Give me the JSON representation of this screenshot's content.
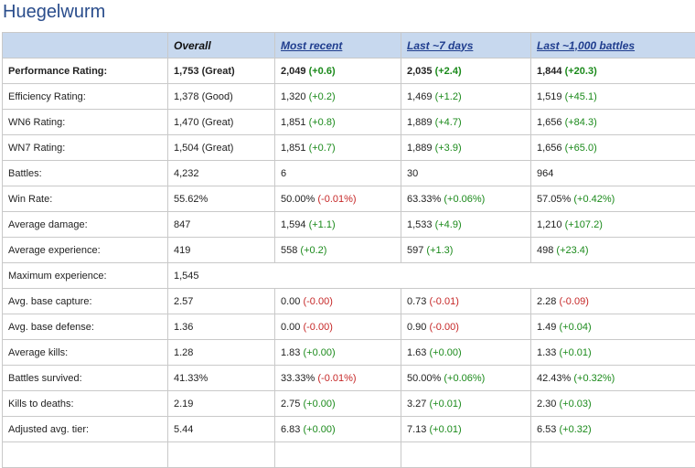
{
  "page": {
    "title": "Huegelwurm"
  },
  "columns": [
    {
      "label": "",
      "link": false
    },
    {
      "label": "Overall",
      "link": false
    },
    {
      "label": "Most recent",
      "link": true
    },
    {
      "label": "Last ~7 days",
      "link": true
    },
    {
      "label": "Last ~1,000 battles",
      "link": true
    }
  ],
  "rows": [
    {
      "label": "Performance Rating:",
      "bold": true,
      "cells": [
        {
          "v": "1,753 (Great)",
          "d": "",
          "s": ""
        },
        {
          "v": "2,049",
          "d": "(+0.6)",
          "s": "up"
        },
        {
          "v": "2,035",
          "d": "(+2.4)",
          "s": "up"
        },
        {
          "v": "1,844",
          "d": "(+20.3)",
          "s": "up"
        }
      ]
    },
    {
      "label": "Efficiency Rating:",
      "bold": false,
      "cells": [
        {
          "v": "1,378 (Good)",
          "d": "",
          "s": ""
        },
        {
          "v": "1,320",
          "d": "(+0.2)",
          "s": "up"
        },
        {
          "v": "1,469",
          "d": "(+1.2)",
          "s": "up"
        },
        {
          "v": "1,519",
          "d": "(+45.1)",
          "s": "up"
        }
      ]
    },
    {
      "label": "WN6 Rating:",
      "bold": false,
      "cells": [
        {
          "v": "1,470 (Great)",
          "d": "",
          "s": ""
        },
        {
          "v": "1,851",
          "d": "(+0.8)",
          "s": "up"
        },
        {
          "v": "1,889",
          "d": "(+4.7)",
          "s": "up"
        },
        {
          "v": "1,656",
          "d": "(+84.3)",
          "s": "up"
        }
      ]
    },
    {
      "label": "WN7 Rating:",
      "bold": false,
      "cells": [
        {
          "v": "1,504 (Great)",
          "d": "",
          "s": ""
        },
        {
          "v": "1,851",
          "d": "(+0.7)",
          "s": "up"
        },
        {
          "v": "1,889",
          "d": "(+3.9)",
          "s": "up"
        },
        {
          "v": "1,656",
          "d": "(+65.0)",
          "s": "up"
        }
      ]
    },
    {
      "label": "Battles:",
      "bold": false,
      "cells": [
        {
          "v": "4,232",
          "d": "",
          "s": ""
        },
        {
          "v": "6",
          "d": "",
          "s": ""
        },
        {
          "v": "30",
          "d": "",
          "s": ""
        },
        {
          "v": "964",
          "d": "",
          "s": ""
        }
      ]
    },
    {
      "label": "Win Rate:",
      "bold": false,
      "cells": [
        {
          "v": "55.62%",
          "d": "",
          "s": ""
        },
        {
          "v": "50.00%",
          "d": "(-0.01%)",
          "s": "down"
        },
        {
          "v": "63.33%",
          "d": "(+0.06%)",
          "s": "up"
        },
        {
          "v": "57.05%",
          "d": "(+0.42%)",
          "s": "up"
        }
      ]
    },
    {
      "label": "Average damage:",
      "bold": false,
      "cells": [
        {
          "v": "847",
          "d": "",
          "s": ""
        },
        {
          "v": "1,594",
          "d": "(+1.1)",
          "s": "up"
        },
        {
          "v": "1,533",
          "d": "(+4.9)",
          "s": "up"
        },
        {
          "v": "1,210",
          "d": "(+107.2)",
          "s": "up"
        }
      ]
    },
    {
      "label": "Average experience:",
      "bold": false,
      "cells": [
        {
          "v": "419",
          "d": "",
          "s": ""
        },
        {
          "v": "558",
          "d": "(+0.2)",
          "s": "up"
        },
        {
          "v": "597",
          "d": "(+1.3)",
          "s": "up"
        },
        {
          "v": "498",
          "d": "(+23.4)",
          "s": "up"
        }
      ]
    },
    {
      "label": "Maximum experience:",
      "bold": false,
      "span": true,
      "cells": [
        {
          "v": "1,545",
          "d": "",
          "s": ""
        }
      ]
    },
    {
      "label": "Avg. base capture:",
      "bold": false,
      "cells": [
        {
          "v": "2.57",
          "d": "",
          "s": ""
        },
        {
          "v": "0.00",
          "d": "(-0.00)",
          "s": "down"
        },
        {
          "v": "0.73",
          "d": "(-0.01)",
          "s": "down"
        },
        {
          "v": "2.28",
          "d": "(-0.09)",
          "s": "down"
        }
      ]
    },
    {
      "label": "Avg. base defense:",
      "bold": false,
      "cells": [
        {
          "v": "1.36",
          "d": "",
          "s": ""
        },
        {
          "v": "0.00",
          "d": "(-0.00)",
          "s": "down"
        },
        {
          "v": "0.90",
          "d": "(-0.00)",
          "s": "down"
        },
        {
          "v": "1.49",
          "d": "(+0.04)",
          "s": "up"
        }
      ]
    },
    {
      "label": "Average kills:",
      "bold": false,
      "cells": [
        {
          "v": "1.28",
          "d": "",
          "s": ""
        },
        {
          "v": "1.83",
          "d": "(+0.00)",
          "s": "up"
        },
        {
          "v": "1.63",
          "d": "(+0.00)",
          "s": "up"
        },
        {
          "v": "1.33",
          "d": "(+0.01)",
          "s": "up"
        }
      ]
    },
    {
      "label": "Battles survived:",
      "bold": false,
      "cells": [
        {
          "v": "41.33%",
          "d": "",
          "s": ""
        },
        {
          "v": "33.33%",
          "d": "(-0.01%)",
          "s": "down"
        },
        {
          "v": "50.00%",
          "d": "(+0.06%)",
          "s": "up"
        },
        {
          "v": "42.43%",
          "d": "(+0.32%)",
          "s": "up"
        }
      ]
    },
    {
      "label": "Kills to deaths:",
      "bold": false,
      "cells": [
        {
          "v": "2.19",
          "d": "",
          "s": ""
        },
        {
          "v": "2.75",
          "d": "(+0.00)",
          "s": "up"
        },
        {
          "v": "3.27",
          "d": "(+0.01)",
          "s": "up"
        },
        {
          "v": "2.30",
          "d": "(+0.03)",
          "s": "up"
        }
      ]
    },
    {
      "label": "Adjusted avg. tier:",
      "bold": false,
      "cells": [
        {
          "v": "5.44",
          "d": "",
          "s": ""
        },
        {
          "v": "6.83",
          "d": "(+0.00)",
          "s": "up"
        },
        {
          "v": "7.13",
          "d": "(+0.01)",
          "s": "up"
        },
        {
          "v": "6.53",
          "d": "(+0.32)",
          "s": "up"
        }
      ]
    },
    {
      "label": "",
      "bold": false,
      "empty": true,
      "cells": []
    }
  ],
  "colors": {
    "header_bg": "#c7d8ee",
    "link": "#1f3d8e",
    "title": "#2a4d8c",
    "positive": "#1b8a1b",
    "negative": "#c62828"
  }
}
